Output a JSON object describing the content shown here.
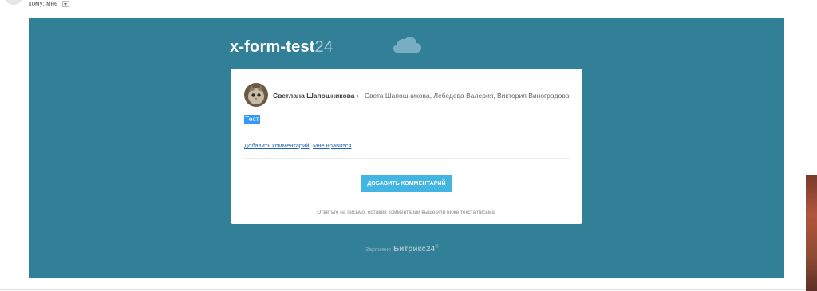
{
  "header": {
    "to_label": "кому:",
    "to_value": "мне"
  },
  "email": {
    "brand_name": "x-form-test",
    "brand_suffix": "24",
    "post": {
      "author": "Светлана Шапошникова",
      "separator": "›",
      "recipients": "Света Шапошникова, Лебедева Валерия, Виктория Виноградова",
      "message": "Тест"
    },
    "links": {
      "add_comment": "Добавить комментарий",
      "like": "Мне нравится"
    },
    "button_label": "ДОБАВИТЬ КОММЕНТАРИЙ",
    "hint": "Ответьте на письмо, оставив комментарий выше или ниже текста письма.",
    "footer": {
      "label": "Заряжено",
      "logo": "Битрикс24",
      "logo_mark": "©"
    }
  },
  "colors": {
    "banner": "#327f98",
    "button": "#43b5e3",
    "link": "#2067b0",
    "selection": "#3399ff"
  }
}
